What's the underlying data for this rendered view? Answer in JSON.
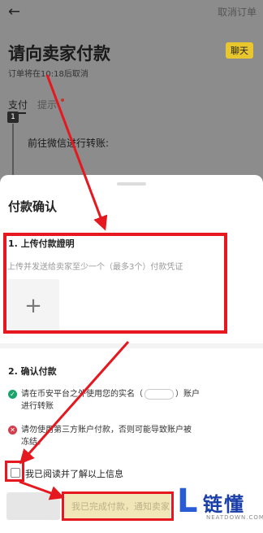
{
  "header": {
    "back_icon": "back-arrow-icon",
    "cancel_order": "取消订单",
    "title": "请向卖家付款",
    "chat_button": "聊天",
    "cancel_note": "订单将在10:18后取消"
  },
  "tabs": {
    "pay": "支付",
    "tips": "提示"
  },
  "step": {
    "number": "1",
    "text": "前往微信进行转账:"
  },
  "sheet": {
    "title": "付款确认",
    "section1_title": "1. 上传付款證明",
    "upload_description": "上传并发送给卖家至少一个（最多3个）付款凭证",
    "upload_plus": "+",
    "section2_title": "2. 确认付款",
    "item1_line1a": "请在币安平台之外使用您的实名（",
    "item1_line1b": "）账户",
    "item1_line2": "进行转账",
    "item2_line1": "请勿使用第三方账户付款，否则可能导致账户被",
    "item2_line2": "冻结。",
    "ack_label": "我已阅读并了解以上信息",
    "done_button": "我已完成付款，通知卖家"
  },
  "watermark": {
    "mark": "L",
    "cn": "链懂",
    "en": "NEATDOWN.COM"
  },
  "colors": {
    "annotation_red": "#e5171f",
    "accent_yellow": "#e7c62e",
    "brand_blue": "#2a5bd7"
  }
}
